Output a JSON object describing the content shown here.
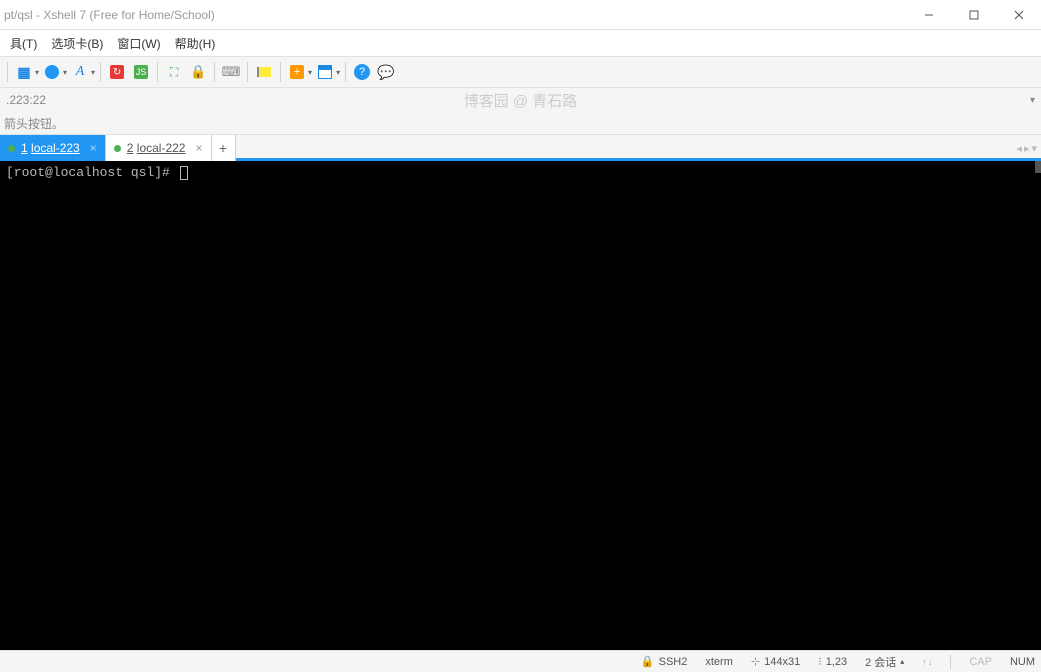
{
  "titlebar": {
    "title": "pt/qsl - Xshell 7 (Free for Home/School)"
  },
  "menubar": {
    "items": [
      {
        "label": "具(T)",
        "key": "T"
      },
      {
        "label": "选项卡(B)",
        "key": "B"
      },
      {
        "label": "窗口(W)",
        "key": "W"
      },
      {
        "label": "帮助(H)",
        "key": "H"
      }
    ]
  },
  "addressbar": {
    "text": ".223:22",
    "watermark": "博客园 @ 青石路"
  },
  "hintbar": {
    "text": "箭头按钮。"
  },
  "tabs": {
    "items": [
      {
        "num": "1",
        "label": "local-223",
        "active": true
      },
      {
        "num": "2",
        "label": "local-222",
        "active": false
      }
    ]
  },
  "terminal": {
    "prompt": "[root@localhost qsl]# "
  },
  "statusbar": {
    "protocol": "SSH2",
    "term": "xterm",
    "size": "144x31",
    "pos": "1,23",
    "sessions": "2 会话",
    "cap": "CAP",
    "num": "NUM"
  }
}
